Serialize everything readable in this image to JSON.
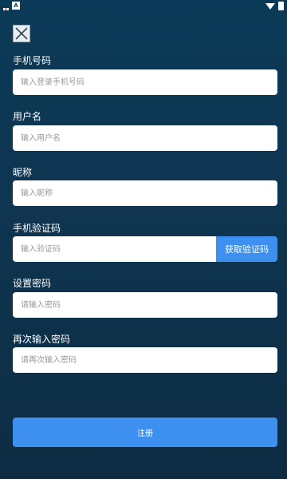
{
  "status_bar": {
    "app_badge": "A"
  },
  "form": {
    "phone": {
      "label": "手机号码",
      "placeholder": "输入登录手机号码"
    },
    "username": {
      "label": "用户名",
      "placeholder": "输入用户名"
    },
    "nickname": {
      "label": "昵称",
      "placeholder": "输入昵称"
    },
    "code": {
      "label": "手机验证码",
      "placeholder": "输入验证码",
      "button": "获取验证码"
    },
    "password": {
      "label": "设置密码",
      "placeholder": "请输入密码"
    },
    "password_confirm": {
      "label": "再次输入密码",
      "placeholder": "请再次输入密码"
    }
  },
  "register_button": "注册",
  "icons": {
    "close": "close-icon",
    "wifi": "wifi-icon",
    "battery": "battery-icon"
  },
  "colors": {
    "background_top": "#0b3a58",
    "background_bottom": "#0d2c44",
    "accent": "#3d8ff0",
    "input_bg": "#ffffff",
    "placeholder": "#9a9a9a"
  }
}
